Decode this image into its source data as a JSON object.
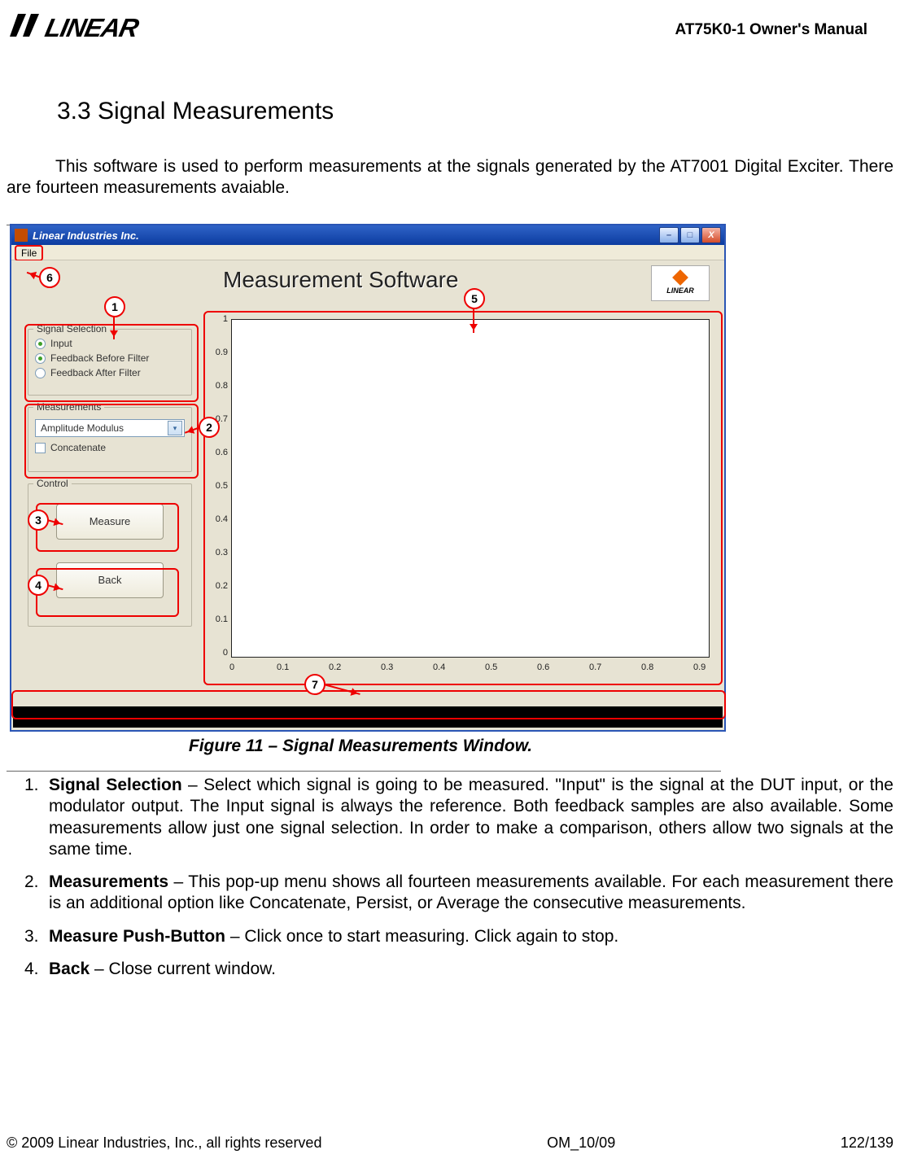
{
  "header": {
    "logoText": "LINEAR",
    "manualTitle": "AT75K0-1 Owner's Manual"
  },
  "section": {
    "heading": "3.3 Signal Measurements",
    "intro": "This software is used to perform measurements at the signals generated by the AT7001 Digital Exciter. There are fourteen measurements avaiable."
  },
  "window": {
    "title": "Linear Industries Inc.",
    "minLabel": "–",
    "maxLabel": "□",
    "closeLabel": "X",
    "menuFile": "File",
    "appTitle": "Measurement Software",
    "miniLogo": "LINEAR",
    "signalSelection": {
      "legend": "Signal Selection",
      "options": [
        "Input",
        "Feedback Before Filter",
        "Feedback After Filter"
      ],
      "selected": 0
    },
    "measurements": {
      "legend": "Measurements",
      "dropdownValue": "Amplitude Modulus",
      "concatenateLabel": "Concatenate"
    },
    "control": {
      "legend": "Control",
      "measureBtn": "Measure",
      "backBtn": "Back"
    }
  },
  "chart_data": {
    "type": "line",
    "title": "",
    "xlabel": "",
    "ylabel": "",
    "xlim": [
      0,
      1
    ],
    "ylim": [
      0,
      1
    ],
    "xticks": [
      0,
      0.1,
      0.2,
      0.3,
      0.4,
      0.5,
      0.6,
      0.7,
      0.8,
      0.9
    ],
    "yticks": [
      0,
      0.1,
      0.2,
      0.3,
      0.4,
      0.5,
      0.6,
      0.7,
      0.8,
      0.9,
      1
    ],
    "series": []
  },
  "callouts": {
    "1": "1",
    "2": "2",
    "3": "3",
    "4": "4",
    "5": "5",
    "6": "6",
    "7": "7"
  },
  "figureCaption": "Figure 11 – Signal Measurements Window.",
  "list": {
    "item1": {
      "num": "1.",
      "title": "Signal Selection",
      "body": " – Select which signal is going to be measured. \"Input\" is the signal at the DUT input, or the modulator output. The Input signal is always the reference. Both feedback samples are also available. Some measurements allow just one signal selection. In order to make a comparison, others allow two signals at the same time."
    },
    "item2": {
      "num": "2.",
      "title": "Measurements",
      "body": " – This pop-up menu shows all fourteen measurements available. For each measurement there is an additional option like Concatenate, Persist, or Average the consecutive measurements."
    },
    "item3": {
      "num": "3.",
      "title": "Measure Push-Button",
      "body": " – Click once to start measuring. Click again to stop."
    },
    "item4": {
      "num": "4.",
      "title": "Back",
      "body": " – Close current window."
    }
  },
  "footer": {
    "copyright": "© 2009 Linear Industries, Inc., all rights reserved",
    "docCode": "OM_10/09",
    "page": "122/139"
  }
}
